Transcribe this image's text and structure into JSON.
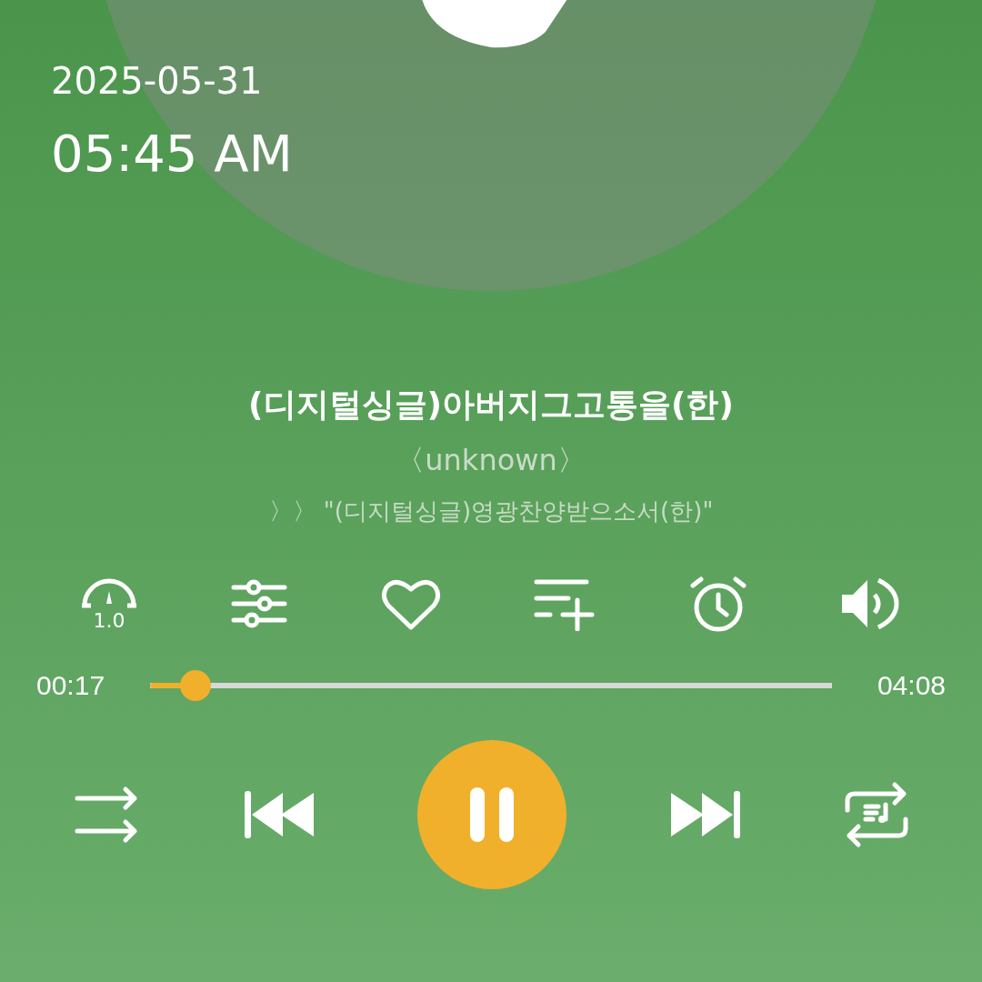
{
  "clock": {
    "date": "2025-05-31",
    "time": "05:45 AM"
  },
  "track": {
    "title": "(디지털싱글)아버지그고통을(한)",
    "artist": "〈unknown〉",
    "next_up": "〉〉 \"(디지털싱글)영광찬양받으소서(한)\""
  },
  "tools": {
    "speed": "1.0",
    "liked": false
  },
  "progress": {
    "elapsed": "00:17",
    "total": "04:08",
    "level": 0.067
  },
  "player": {
    "playing": true
  }
}
